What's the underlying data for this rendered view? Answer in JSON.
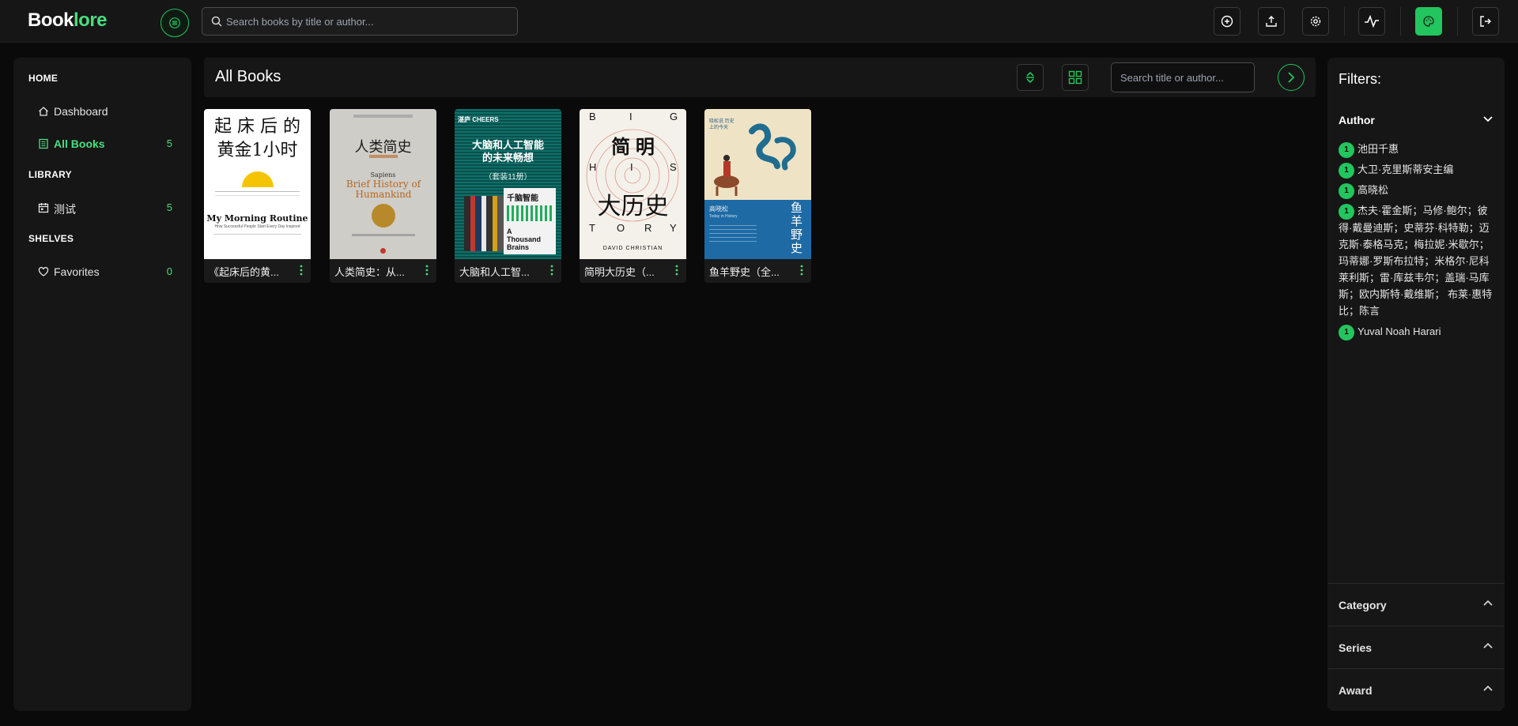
{
  "app": {
    "logo_part1": "Book",
    "logo_part2": "lore"
  },
  "topbar": {
    "search_placeholder": "Search books by title or author...",
    "buttons": [
      {
        "name": "add-book",
        "icon": "plus-circle-icon"
      },
      {
        "name": "upload",
        "icon": "upload-icon"
      },
      {
        "name": "settings",
        "icon": "gear-icon"
      },
      {
        "name": "activity",
        "icon": "activity-icon"
      },
      {
        "name": "theme",
        "icon": "palette-icon",
        "active": true
      },
      {
        "name": "logout",
        "icon": "logout-icon"
      }
    ]
  },
  "sidebar": {
    "home_title": "HOME",
    "library_title": "LIBRARY",
    "shelves_title": "SHELVES",
    "dashboard": {
      "label": "Dashboard"
    },
    "all_books": {
      "label": "All Books",
      "count": "5"
    },
    "library_item": {
      "label": "测试",
      "count": "5"
    },
    "favorites": {
      "label": "Favorites",
      "count": "0"
    }
  },
  "main": {
    "title": "All Books",
    "search_placeholder": "Search title or author...",
    "books": [
      {
        "title": "《起床后的黄...",
        "cover_line1": "起 床 后 的",
        "cover_line2": "黄金1小时",
        "cover_sub": "My Morning Routine",
        "cover_sub2": "How Successful People Start Every Day Inspired"
      },
      {
        "title": "人类简史：从...",
        "cover_line1": "人类简史",
        "cover_sub": "Sapiens",
        "cover_sub2": "Brief History of Humankind"
      },
      {
        "title": "大脑和人工智...",
        "cover_top": "湛庐 CHEERS",
        "cover_line1": "大脑和人工智能",
        "cover_line2": "的未来畅想",
        "cover_sub": "（套装11册）",
        "cover_sub2": "千脑智能",
        "cover_sub3": "A Thousand Brains"
      },
      {
        "title": "简明大历史（...",
        "cover_big": [
          "B",
          "I",
          "G",
          "H",
          "I",
          "S",
          "T",
          "O",
          "R",
          "Y"
        ],
        "cover_line1": "简 明",
        "cover_line2": "大历史",
        "cover_sub": "DAVID CHRISTIAN"
      },
      {
        "title": "鱼羊野史（全...",
        "cover_top": "晓松说 历史上的今天",
        "cover_line1": "鱼羊野史",
        "cover_sub": "高晓松",
        "cover_sub2": "Today in History"
      }
    ]
  },
  "filters": {
    "title": "Filters:",
    "author_label": "Author",
    "authors": [
      {
        "count": "1",
        "name": "池田千惠"
      },
      {
        "count": "1",
        "name": "大卫·克里斯蒂安主编"
      },
      {
        "count": "1",
        "name": "高晓松"
      },
      {
        "count": "1",
        "name": "杰夫·霍金斯；马修·鲍尔；彼得·戴曼迪斯；史蒂芬·科特勒；迈克斯·泰格马克；梅拉妮·米歇尔；玛蒂娜·罗斯布拉特；米格尔·尼科莱利斯；雷·库兹韦尔；盖瑞·马库斯；欧内斯特·戴维斯； 布莱·惠特比；陈言"
      },
      {
        "count": "1",
        "name": "Yuval Noah Harari"
      }
    ],
    "collapsed": [
      "Category",
      "Series",
      "Award"
    ]
  },
  "colors": {
    "accent": "#22c55e",
    "accent_text": "#4ade80",
    "background": "#0a0a0a",
    "panel": "#161616"
  }
}
